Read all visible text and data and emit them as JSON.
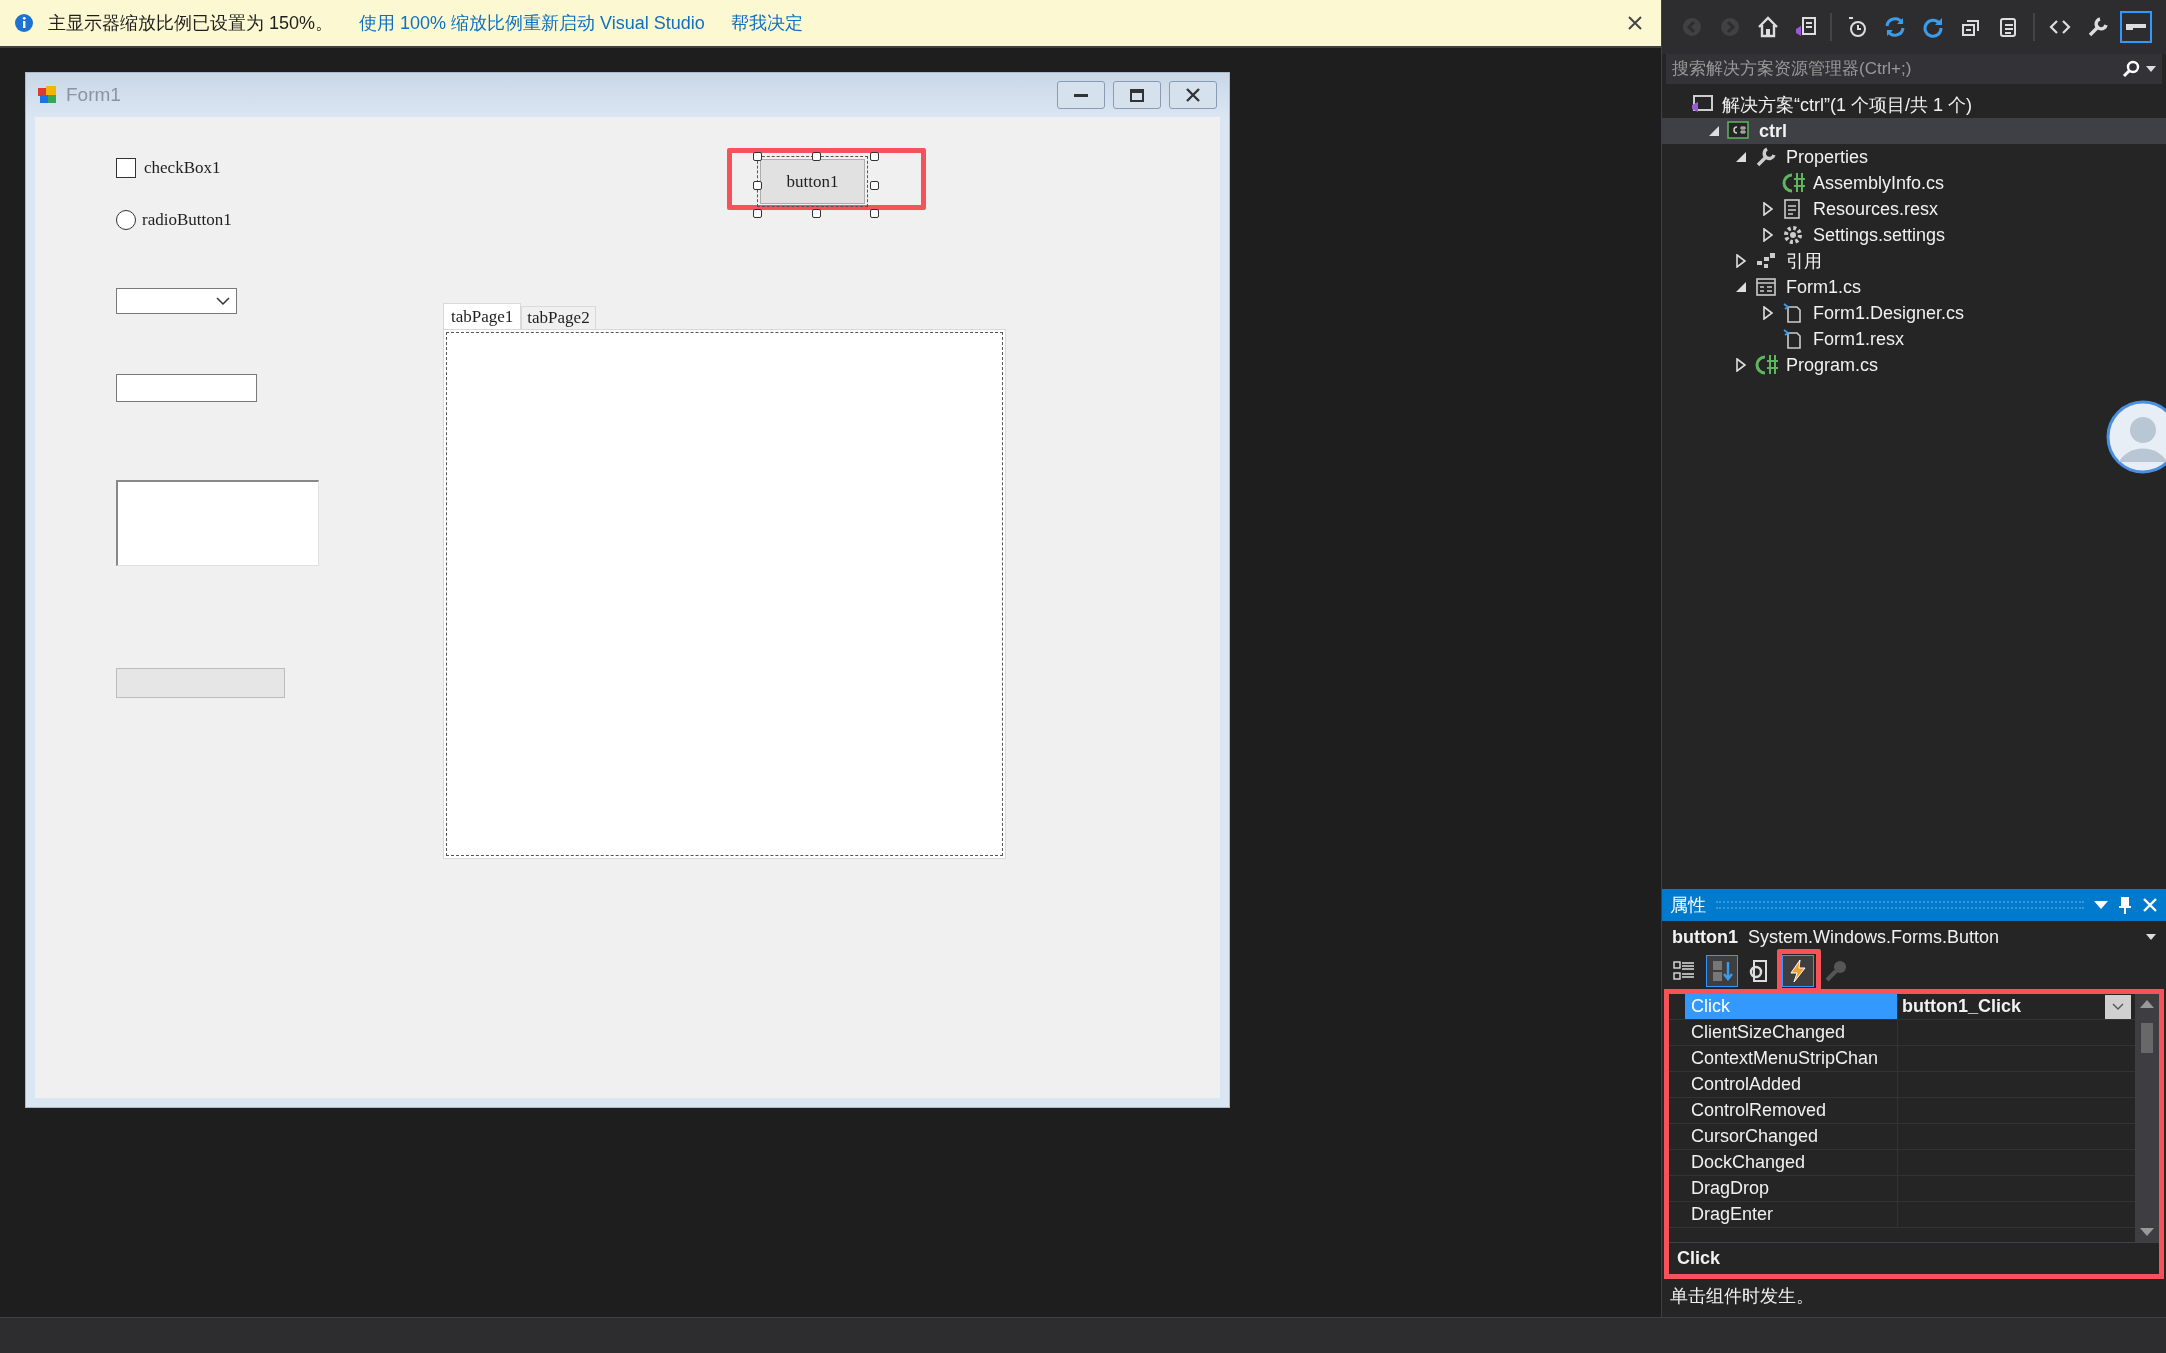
{
  "info_bar": {
    "message": "主显示器缩放比例已设置为 150%。",
    "links": [
      "使用 100% 缩放比例重新启动 Visual Studio",
      "帮我决定"
    ]
  },
  "designer": {
    "form_title": "Form1",
    "controls": [
      {
        "kind": "checkbox",
        "label": "checkBox1",
        "checked": false
      },
      {
        "kind": "radio",
        "label": "radioButton1",
        "checked": false
      },
      {
        "kind": "combobox"
      },
      {
        "kind": "textbox"
      },
      {
        "kind": "listbox"
      },
      {
        "kind": "progressbar",
        "level": 0
      },
      {
        "kind": "button",
        "label": "button1",
        "selected": true
      },
      {
        "kind": "tabcontrol",
        "tabs": [
          {
            "label": "tabPage1",
            "selected": true
          },
          {
            "label": "tabPage2",
            "selected": false
          }
        ]
      }
    ]
  },
  "solution_explorer": {
    "toolbar": [
      {
        "kind": "back",
        "disabled": true,
        "selected": false
      },
      {
        "kind": "forward",
        "disabled": true,
        "selected": false
      },
      {
        "kind": "home",
        "disabled": false,
        "selected": false
      },
      {
        "kind": "switch_views",
        "disabled": false,
        "selected": false
      },
      {
        "kind": "pending_changes",
        "disabled": false,
        "selected": false
      },
      {
        "kind": "sync",
        "disabled": false,
        "selected": false
      },
      {
        "kind": "refresh",
        "disabled": false,
        "selected": false
      },
      {
        "kind": "collapse_all",
        "disabled": false,
        "selected": false
      },
      {
        "kind": "show_all_files",
        "disabled": false,
        "selected": false
      },
      {
        "kind": "view_code",
        "disabled": false,
        "selected": false
      },
      {
        "kind": "properties",
        "disabled": false,
        "selected": false
      },
      {
        "kind": "preview",
        "disabled": false,
        "selected": true
      }
    ],
    "search_placeholder": "搜索解决方案资源管理器(Ctrl+;)",
    "tree": [
      {
        "kind": "solution",
        "label": "解决方案“ctrl”(1 个项目/共 1 个)",
        "selected": false,
        "children": [
          {
            "kind": "project",
            "label": "ctrl",
            "expanded": true,
            "selected": true,
            "children": [
              {
                "kind": "properties",
                "label": "Properties",
                "expanded": true,
                "selected": false,
                "children": [
                  {
                    "kind": "cs",
                    "label": "AssemblyInfo.cs",
                    "selected": false
                  },
                  {
                    "kind": "resx",
                    "label": "Resources.resx",
                    "expanded": false,
                    "selected": false
                  },
                  {
                    "kind": "settings",
                    "label": "Settings.settings",
                    "expanded": false,
                    "selected": false
                  }
                ]
              },
              {
                "kind": "references",
                "label": "引用",
                "expanded": false,
                "selected": false
              },
              {
                "kind": "form",
                "label": "Form1.cs",
                "expanded": true,
                "selected": false,
                "children": [
                  {
                    "kind": "file",
                    "label": "Form1.Designer.cs",
                    "expanded": false,
                    "selected": false
                  },
                  {
                    "kind": "file",
                    "label": "Form1.resx",
                    "selected": false
                  }
                ]
              },
              {
                "kind": "cs",
                "label": "Program.cs",
                "expanded": false,
                "selected": false
              }
            ]
          }
        ]
      }
    ]
  },
  "properties": {
    "title": "属性",
    "object_name": "button1",
    "object_type": "System.Windows.Forms.Button",
    "toolbar": [
      {
        "kind": "categorized",
        "selected": false,
        "disabled": false
      },
      {
        "kind": "alphabetical",
        "selected": true,
        "disabled": false
      },
      {
        "kind": "properties",
        "selected": false,
        "disabled": false
      },
      {
        "kind": "events",
        "selected": true,
        "disabled": false
      },
      {
        "kind": "property_pages",
        "selected": false,
        "disabled": true
      }
    ],
    "rows": [
      {
        "name": "Click",
        "value": "button1_Click",
        "selected": true
      },
      {
        "name": "ClientSizeChanged",
        "selected": false
      },
      {
        "name": "ContextMenuStripChan",
        "selected": false
      },
      {
        "name": "ControlAdded",
        "selected": false
      },
      {
        "name": "ControlRemoved",
        "selected": false
      },
      {
        "name": "CursorChanged",
        "selected": false
      },
      {
        "name": "DockChanged",
        "selected": false
      },
      {
        "name": "DragDrop",
        "selected": false
      },
      {
        "name": "DragEnter",
        "selected": false
      }
    ],
    "description": {
      "title": "Click",
      "text": "单击组件时发生。"
    }
  }
}
